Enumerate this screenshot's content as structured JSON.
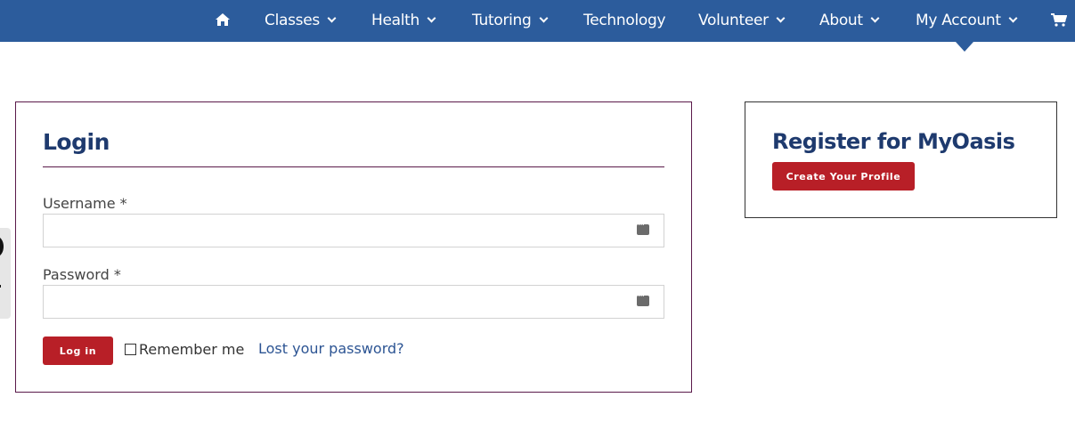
{
  "nav": {
    "home_icon": "home-icon",
    "items": [
      {
        "label": "Classes",
        "has_dropdown": true
      },
      {
        "label": "Health",
        "has_dropdown": true
      },
      {
        "label": "Tutoring",
        "has_dropdown": true
      },
      {
        "label": "Technology",
        "has_dropdown": false
      },
      {
        "label": "Volunteer",
        "has_dropdown": true
      },
      {
        "label": "About",
        "has_dropdown": true
      },
      {
        "label": "My Account",
        "has_dropdown": true,
        "active": true
      }
    ],
    "cart_icon": "shopping-cart-icon",
    "background_color": "#2c5c9c"
  },
  "login": {
    "title": "Login",
    "username_label": "Username *",
    "username_value": "",
    "password_label": "Password *",
    "password_value": "",
    "password_manager_icon": "password-manager-icon",
    "login_button": "Log in",
    "remember_me_label": "Remember me",
    "remember_me_checked": false,
    "lost_password_link": "Lost your password?"
  },
  "register": {
    "title": "Register for MyOasis",
    "create_profile_button": "Create Your Profile"
  },
  "colors": {
    "heading": "#1e3a6e",
    "button": "#b81f27",
    "link": "#2c5493",
    "box_border": "#5a1a4a"
  }
}
